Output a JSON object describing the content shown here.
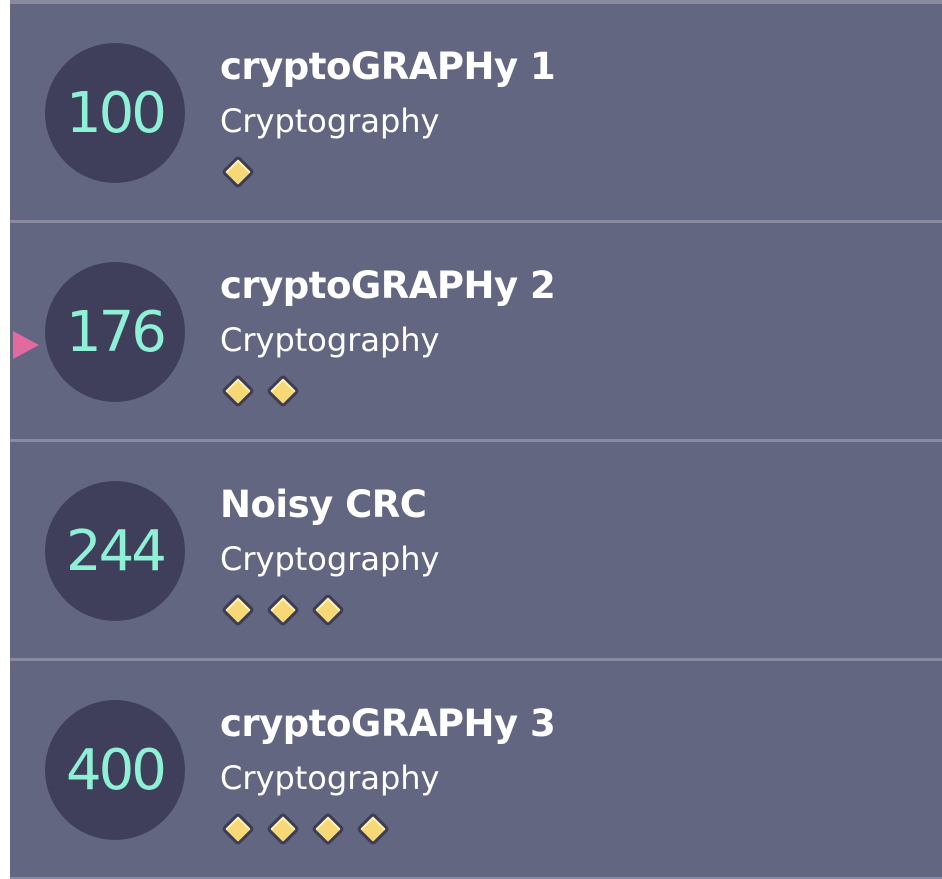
{
  "challenges": [
    {
      "points": "100",
      "name": "cryptoGRAPHy 1",
      "category": "Cryptography",
      "difficulty": 1,
      "selected": false
    },
    {
      "points": "176",
      "name": "cryptoGRAPHy 2",
      "category": "Cryptography",
      "difficulty": 2,
      "selected": true
    },
    {
      "points": "244",
      "name": "Noisy CRC",
      "category": "Cryptography",
      "difficulty": 3,
      "selected": false
    },
    {
      "points": "400",
      "name": "cryptoGRAPHy 3",
      "category": "Cryptography",
      "difficulty": 4,
      "selected": false
    }
  ],
  "colors": {
    "row_background": "#636681",
    "badge_background": "#3f3f5c",
    "points_text": "#8ef0d4",
    "diamond_fill": "#f6d877",
    "selection_pointer": "#e26a9f"
  },
  "icons": {
    "difficulty": "diamond-icon",
    "selection": "pointer-arrow-icon"
  }
}
